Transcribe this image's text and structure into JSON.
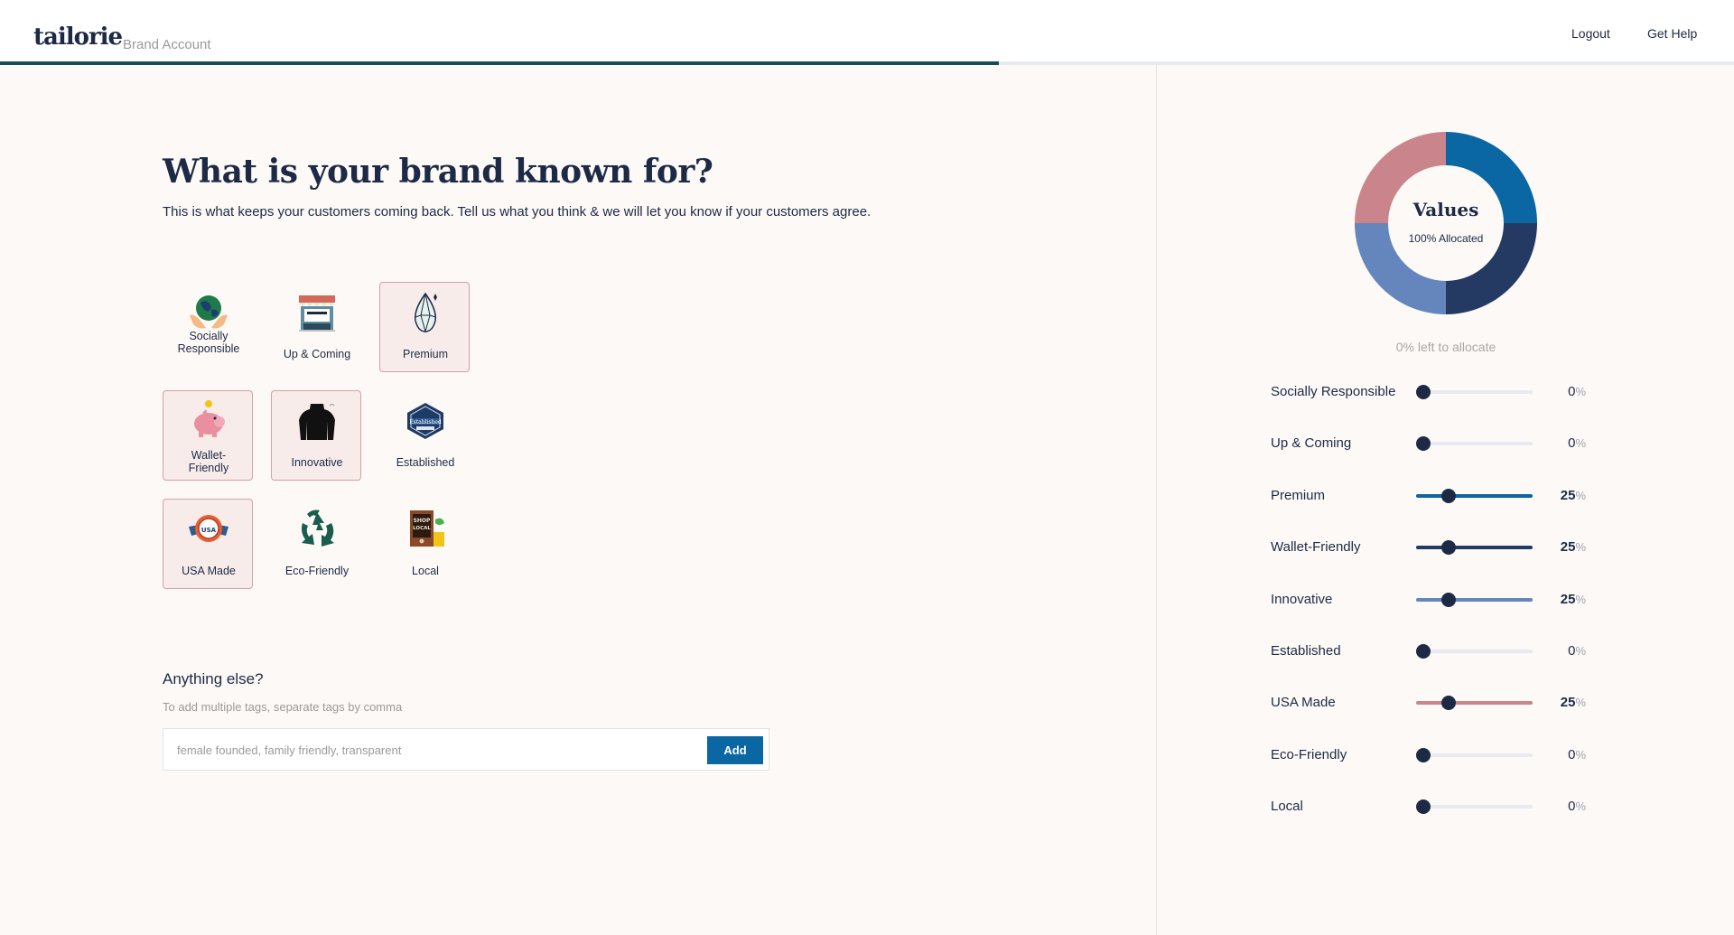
{
  "header": {
    "logo": "tailorie",
    "subtitle": "Brand Account",
    "nav": {
      "logout": "Logout",
      "help": "Get Help"
    },
    "progress": 0.6
  },
  "main": {
    "title": "What is your brand known for?",
    "subtitle": "This is what keeps your customers coming back. Tell us what you think & we will let you know if your customers agree.",
    "tiles": [
      {
        "label": "Socially Responsible",
        "icon": "globe-hands-icon",
        "selected": false
      },
      {
        "label": "Up & Coming",
        "icon": "storefront-icon",
        "selected": false
      },
      {
        "label": "Premium",
        "icon": "diamond-icon",
        "selected": true
      },
      {
        "label": "Wallet-Friendly",
        "icon": "piggy-bank-icon",
        "selected": true
      },
      {
        "label": "Innovative",
        "icon": "turtleneck-icon",
        "selected": true
      },
      {
        "label": "Established",
        "icon": "established-badge-icon",
        "selected": false
      },
      {
        "label": "USA Made",
        "icon": "usa-made-badge-icon",
        "selected": true
      },
      {
        "label": "Eco-Friendly",
        "icon": "recycle-icon",
        "selected": false
      },
      {
        "label": "Local",
        "icon": "shop-local-sign-icon",
        "selected": false
      }
    ],
    "anything_else": {
      "heading": "Anything else?",
      "hint": "To add multiple tags, separate tags by comma",
      "placeholder": "female founded, family friendly, transparent",
      "add_label": "Add"
    }
  },
  "values_panel": {
    "title": "Values",
    "allocated": "100% Allocated",
    "left_to_allocate": "0% left to allocate",
    "percent_symbol": "%",
    "colors": {
      "premium": "#0a67a3",
      "wallet": "#243a63",
      "innovative": "#6586bc",
      "usa": "#c9848c",
      "thumb": "#1c2a45",
      "track": "#e7eaef"
    },
    "sliders": [
      {
        "label": "Socially Responsible",
        "value": 0,
        "color": "#1c2a45"
      },
      {
        "label": "Up & Coming",
        "value": 0,
        "color": "#1c2a45"
      },
      {
        "label": "Premium",
        "value": 25,
        "color": "#0a67a3"
      },
      {
        "label": "Wallet-Friendly",
        "value": 25,
        "color": "#243a63"
      },
      {
        "label": "Innovative",
        "value": 25,
        "color": "#6586bc"
      },
      {
        "label": "Established",
        "value": 0,
        "color": "#1c2a45"
      },
      {
        "label": "USA Made",
        "value": 25,
        "color": "#c9848c"
      },
      {
        "label": "Eco-Friendly",
        "value": 0,
        "color": "#1c2a45"
      },
      {
        "label": "Local",
        "value": 0,
        "color": "#1c2a45"
      }
    ]
  }
}
